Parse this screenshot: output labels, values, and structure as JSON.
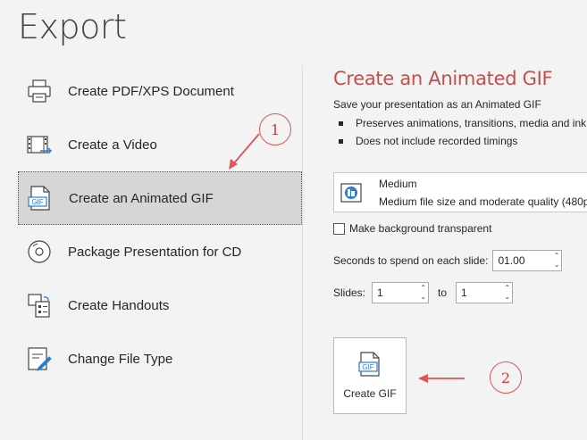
{
  "page": {
    "title": "Export"
  },
  "nav": {
    "items": [
      {
        "label": "Create PDF/XPS Document",
        "icon": "printer-icon"
      },
      {
        "label": "Create a Video",
        "icon": "video-icon"
      },
      {
        "label": "Create an Animated GIF",
        "icon": "gif-icon",
        "selected": true
      },
      {
        "label": "Package Presentation for CD",
        "icon": "cd-icon"
      },
      {
        "label": "Create Handouts",
        "icon": "handouts-icon"
      },
      {
        "label": "Change File Type",
        "icon": "change-file-type-icon"
      }
    ]
  },
  "panel": {
    "title": "Create an Animated GIF",
    "description": "Save your presentation as an Animated GIF",
    "bullets": [
      "Preserves animations, transitions, media and ink",
      "Does not include recorded timings"
    ],
    "quality": {
      "name": "Medium",
      "detail": "Medium file size and moderate quality (480p"
    },
    "transparent": {
      "label": "Make background transparent",
      "checked": false
    },
    "seconds": {
      "label": "Seconds to spend on each slide:",
      "value": "01.00"
    },
    "slides": {
      "label": "Slides:",
      "from": "1",
      "to_label": "to",
      "to": "1"
    },
    "create_button": {
      "label": "Create GIF"
    }
  },
  "annotations": [
    {
      "number": "1"
    },
    {
      "number": "2"
    }
  ],
  "colors": {
    "accent": "#c0504d",
    "annotation": "#e05555",
    "selected_bg": "#d6d6d6",
    "background": "#f3f3f3"
  }
}
